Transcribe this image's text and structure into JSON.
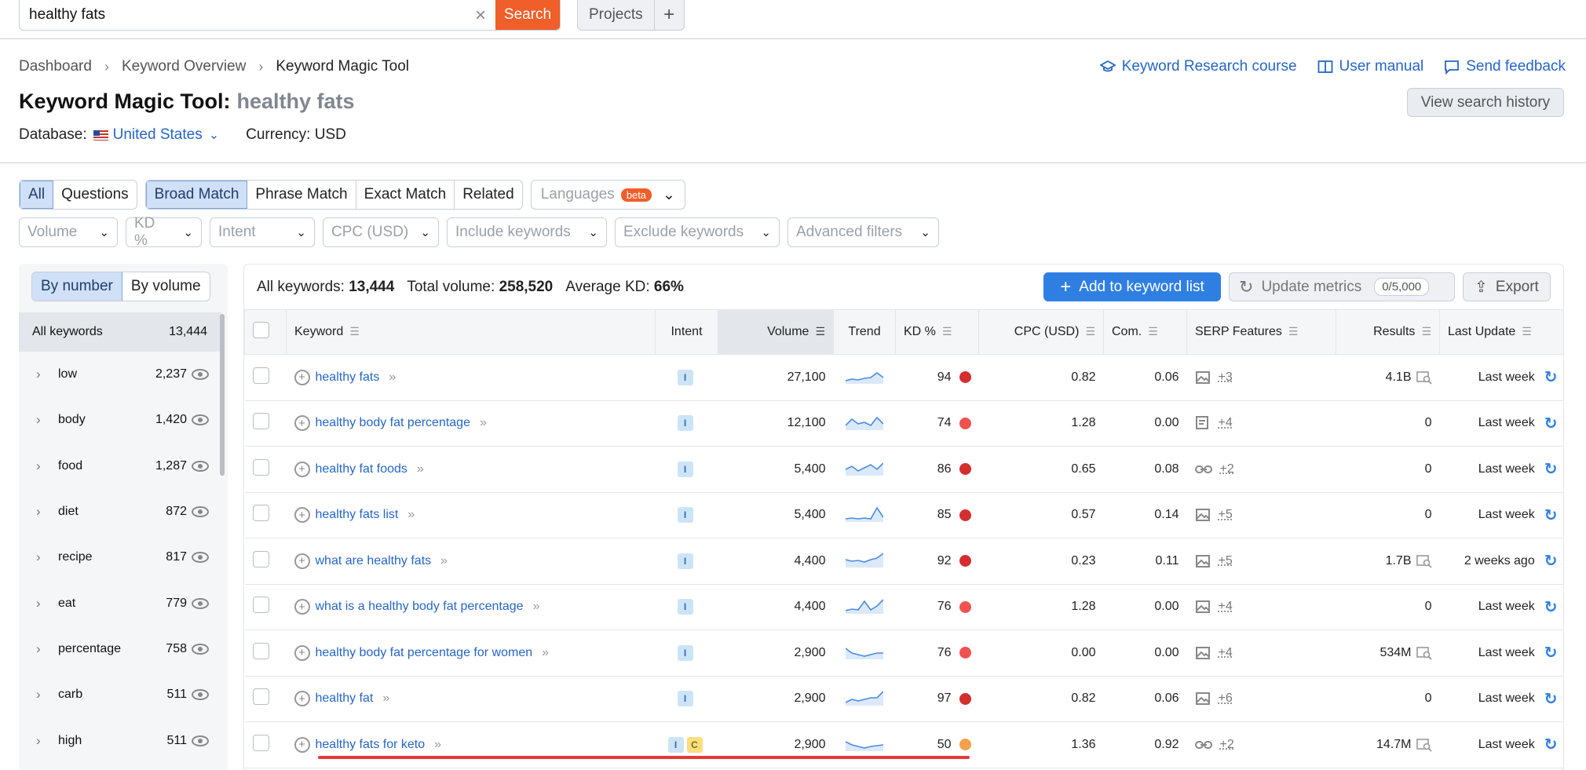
{
  "search": {
    "value": "healthy fats",
    "button": "Search"
  },
  "projects": {
    "label": "Projects",
    "plus": "+"
  },
  "breadcrumb": [
    "Dashboard",
    "Keyword Overview",
    "Keyword Magic Tool"
  ],
  "links": {
    "course": "Keyword Research course",
    "manual": "User manual",
    "feedback": "Send feedback"
  },
  "title": {
    "tool": "Keyword Magic Tool:",
    "keyword": "healthy fats"
  },
  "history_button": "View search history",
  "database": {
    "label": "Database:",
    "value": "United States",
    "currency": "Currency: USD"
  },
  "filters": {
    "scope": [
      "All",
      "Questions"
    ],
    "match": [
      "Broad Match",
      "Phrase Match",
      "Exact Match",
      "Related"
    ],
    "languages": "Languages",
    "beta": "beta",
    "dropdowns": [
      "Volume",
      "KD %",
      "Intent",
      "CPC (USD)",
      "Include keywords",
      "Exclude keywords",
      "Advanced filters"
    ]
  },
  "sidebar": {
    "toggle": [
      "By number",
      "By volume"
    ],
    "all_label": "All keywords",
    "all_count": "13,444",
    "items": [
      {
        "name": "low",
        "count": "2,237"
      },
      {
        "name": "body",
        "count": "1,420"
      },
      {
        "name": "food",
        "count": "1,287"
      },
      {
        "name": "diet",
        "count": "872"
      },
      {
        "name": "recipe",
        "count": "817"
      },
      {
        "name": "eat",
        "count": "779"
      },
      {
        "name": "percentage",
        "count": "758"
      },
      {
        "name": "carb",
        "count": "511"
      },
      {
        "name": "high",
        "count": "511"
      }
    ]
  },
  "summary": {
    "all_label": "All keywords:",
    "all_value": "13,444",
    "vol_label": "Total volume:",
    "vol_value": "258,520",
    "kd_label": "Average KD:",
    "kd_value": "66%"
  },
  "actions": {
    "add": "Add to keyword list",
    "update": "Update metrics",
    "quota": "0/5,000",
    "export": "Export"
  },
  "table": {
    "headers": [
      "Keyword",
      "Intent",
      "Volume",
      "Trend",
      "KD %",
      "CPC (USD)",
      "Com.",
      "SERP Features",
      "Results",
      "Last Update"
    ],
    "rows": [
      {
        "keyword": "healthy fats",
        "intent": [
          "I"
        ],
        "volume": "27,100",
        "kd": "94",
        "kd_color": "#d32f2f",
        "cpc": "0.82",
        "com": "0.06",
        "serp_icon": "image-icon",
        "serp": "+3",
        "results": "4.1B",
        "serp_preview": true,
        "update": "Last week"
      },
      {
        "keyword": "healthy body fat percentage",
        "intent": [
          "I"
        ],
        "volume": "12,100",
        "kd": "74",
        "kd_color": "#ef5350",
        "cpc": "1.28",
        "com": "0.00",
        "serp_icon": "snippet-icon",
        "serp": "+4",
        "results": "0",
        "serp_preview": false,
        "update": "Last week"
      },
      {
        "keyword": "healthy fat foods",
        "intent": [
          "I"
        ],
        "volume": "5,400",
        "kd": "86",
        "kd_color": "#d32f2f",
        "cpc": "0.65",
        "com": "0.08",
        "serp_icon": "link-icon",
        "serp": "+2",
        "results": "0",
        "serp_preview": false,
        "update": "Last week"
      },
      {
        "keyword": "healthy fats list",
        "intent": [
          "I"
        ],
        "volume": "5,400",
        "kd": "85",
        "kd_color": "#d32f2f",
        "cpc": "0.57",
        "com": "0.14",
        "serp_icon": "image-icon",
        "serp": "+5",
        "results": "0",
        "serp_preview": false,
        "update": "Last week"
      },
      {
        "keyword": "what are healthy fats",
        "intent": [
          "I"
        ],
        "volume": "4,400",
        "kd": "92",
        "kd_color": "#d32f2f",
        "cpc": "0.23",
        "com": "0.11",
        "serp_icon": "image-icon",
        "serp": "+5",
        "results": "1.7B",
        "serp_preview": true,
        "update": "2 weeks ago"
      },
      {
        "keyword": "what is a healthy body fat percentage",
        "intent": [
          "I"
        ],
        "volume": "4,400",
        "kd": "76",
        "kd_color": "#ef5350",
        "cpc": "1.28",
        "com": "0.00",
        "serp_icon": "image-icon",
        "serp": "+4",
        "results": "0",
        "serp_preview": false,
        "update": "Last week"
      },
      {
        "keyword": "healthy body fat percentage for women",
        "intent": [
          "I"
        ],
        "volume": "2,900",
        "kd": "76",
        "kd_color": "#ef5350",
        "cpc": "0.00",
        "com": "0.00",
        "serp_icon": "image-icon",
        "serp": "+4",
        "results": "534M",
        "serp_preview": true,
        "update": "Last week"
      },
      {
        "keyword": "healthy fat",
        "intent": [
          "I"
        ],
        "volume": "2,900",
        "kd": "97",
        "kd_color": "#d32f2f",
        "cpc": "0.82",
        "com": "0.06",
        "serp_icon": "image-icon",
        "serp": "+6",
        "results": "0",
        "serp_preview": false,
        "update": "Last week"
      },
      {
        "keyword": "healthy fats for keto",
        "intent": [
          "I",
          "C"
        ],
        "volume": "2,900",
        "kd": "50",
        "kd_color": "#f5a04a",
        "cpc": "1.36",
        "com": "0.92",
        "serp_icon": "link-icon",
        "serp": "+2",
        "results": "14.7M",
        "serp_preview": true,
        "update": "Last week"
      }
    ]
  }
}
